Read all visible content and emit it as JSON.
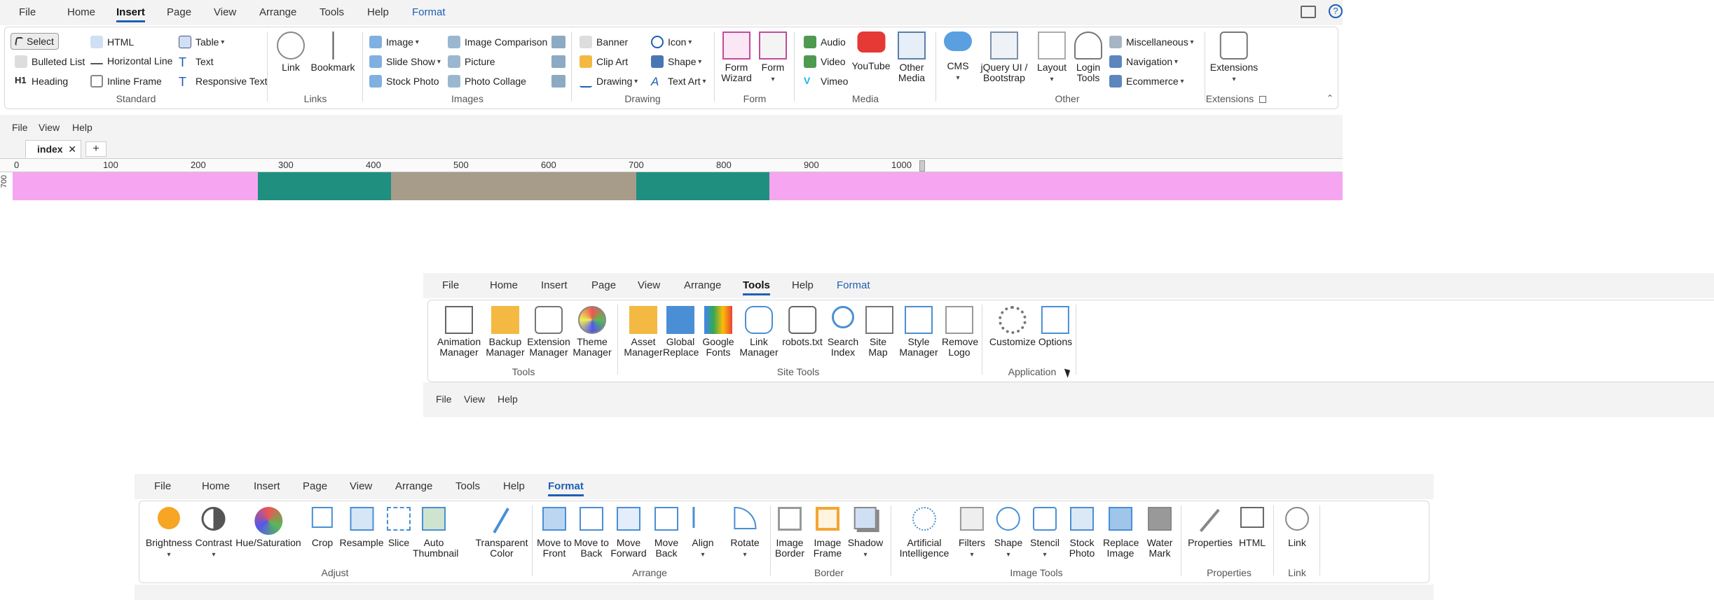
{
  "window": {
    "device_icon": "device-icon",
    "help_icon": "help-icon"
  },
  "panel1": {
    "tabs": [
      "File",
      "Home",
      "Insert",
      "Page",
      "View",
      "Arrange",
      "Tools",
      "Help",
      "Format"
    ],
    "active_tab": "Insert",
    "groups": {
      "standard": {
        "label": "Standard",
        "items": [
          "Select",
          "Bulleted List",
          "Heading",
          "HTML",
          "Horizontal Line",
          "Inline Frame",
          "Table",
          "Text",
          "Responsive Text"
        ]
      },
      "links": {
        "label": "Links",
        "items": [
          "Link",
          "Bookmark"
        ]
      },
      "images": {
        "label": "Images",
        "items": [
          "Image",
          "Slide Show",
          "Stock Photo",
          "Image Comparison",
          "Picture",
          "Photo Collage"
        ]
      },
      "drawing": {
        "label": "Drawing",
        "items": [
          "Banner",
          "Clip Art",
          "Drawing",
          "Icon",
          "Shape",
          "Text Art"
        ]
      },
      "form": {
        "label": "Form",
        "items": [
          "Form Wizard",
          "Form"
        ]
      },
      "media": {
        "label": "Media",
        "items": [
          "Audio",
          "Video",
          "Vimeo",
          "YouTube",
          "Other Media"
        ]
      },
      "other": {
        "label": "Other",
        "items": [
          "CMS",
          "jQuery UI / Bootstrap",
          "Layout",
          "Login Tools",
          "Miscellaneous",
          "Navigation",
          "Ecommerce"
        ]
      },
      "extensions": {
        "label": "Extensions",
        "items": [
          "Extensions"
        ]
      }
    },
    "menubar": [
      "File",
      "View",
      "Help"
    ],
    "doc_tab": "index",
    "new_tab": "+",
    "ruler": [
      "0",
      "100",
      "200",
      "300",
      "400",
      "500",
      "600",
      "700",
      "800",
      "900",
      "1000"
    ],
    "vruler": "700"
  },
  "panel2": {
    "tabs": [
      "File",
      "Home",
      "Insert",
      "Page",
      "View",
      "Arrange",
      "Tools",
      "Help",
      "Format"
    ],
    "active_tab": "Tools",
    "groups": {
      "tools": {
        "label": "Tools",
        "items": [
          "Animation Manager",
          "Backup Manager",
          "Extension Manager",
          "Theme Manager"
        ]
      },
      "site_tools": {
        "label": "Site Tools",
        "items": [
          "Asset Manager",
          "Global Replace",
          "Google Fonts",
          "Link Manager",
          "robots.txt",
          "Search Index",
          "Site Map",
          "Style Manager",
          "Remove Logo"
        ]
      },
      "application": {
        "label": "Application",
        "items": [
          "Customize",
          "Options"
        ]
      }
    },
    "menubar": [
      "File",
      "View",
      "Help"
    ]
  },
  "panel3": {
    "tabs": [
      "File",
      "Home",
      "Insert",
      "Page",
      "View",
      "Arrange",
      "Tools",
      "Help",
      "Format"
    ],
    "active_tab": "Format",
    "groups": {
      "adjust": {
        "label": "Adjust",
        "items": [
          "Brightness",
          "Contrast",
          "Hue/Saturation",
          "Crop",
          "Resample",
          "Slice",
          "Auto Thumbnail",
          "Transparent Color"
        ]
      },
      "arrange": {
        "label": "Arrange",
        "items": [
          "Move to Front",
          "Move to Back",
          "Move Forward",
          "Move Back",
          "Align",
          "Rotate"
        ]
      },
      "border": {
        "label": "Border",
        "items": [
          "Image Border",
          "Image Frame",
          "Shadow"
        ]
      },
      "image_tools": {
        "label": "Image Tools",
        "items": [
          "Artificial Intelligence",
          "Filters",
          "Shape",
          "Stencil",
          "Stock Photo",
          "Replace Image",
          "Water Mark"
        ]
      },
      "properties": {
        "label": "Properties",
        "items": [
          "Properties",
          "HTML"
        ]
      },
      "link": {
        "label": "Link",
        "items": [
          "Link"
        ]
      }
    }
  },
  "colors": {
    "accent": "#1f5fb5",
    "tabbar": "#f3f3f3",
    "canvas_bg": "#f6a6f0",
    "photo": "#1f8f80"
  }
}
